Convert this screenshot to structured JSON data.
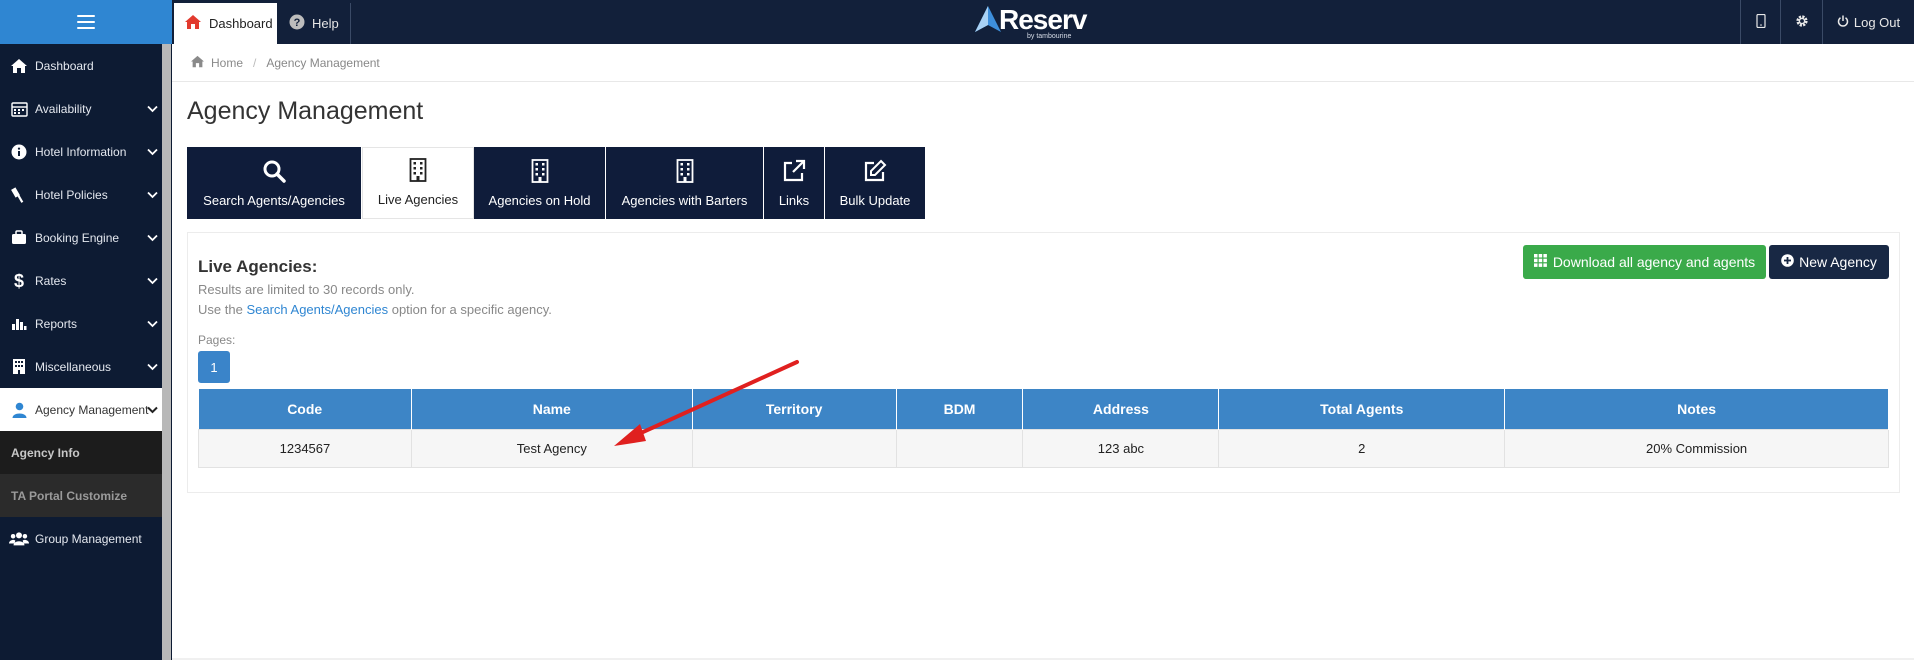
{
  "topbar": {
    "dashboard_label": "Dashboard",
    "help_label": "Help",
    "logo_text": "Reserv",
    "logo_by": "by tambourine",
    "logout_label": "Log Out"
  },
  "sidebar": {
    "items": [
      {
        "label": "Dashboard"
      },
      {
        "label": "Availability"
      },
      {
        "label": "Hotel Information"
      },
      {
        "label": "Hotel Policies"
      },
      {
        "label": "Booking Engine"
      },
      {
        "label": "Rates"
      },
      {
        "label": "Reports"
      },
      {
        "label": "Miscellaneous"
      },
      {
        "label": "Agency Management"
      },
      {
        "label": "Group Management"
      }
    ],
    "sub_items": [
      {
        "label": "Agency Info"
      },
      {
        "label": "TA Portal Customize"
      }
    ]
  },
  "breadcrumb": {
    "home": "Home",
    "separator": "/",
    "current": "Agency Management"
  },
  "page": {
    "title": "Agency Management"
  },
  "tabs": [
    {
      "label": "Search Agents/Agencies",
      "icon": "search-icon"
    },
    {
      "label": "Live Agencies",
      "icon": "building-icon"
    },
    {
      "label": "Agencies on Hold",
      "icon": "building-icon"
    },
    {
      "label": "Agencies with Barters",
      "icon": "building-icon"
    },
    {
      "label": "Links",
      "icon": "external-link-icon"
    },
    {
      "label": "Bulk Update",
      "icon": "edit-icon"
    }
  ],
  "panel": {
    "heading": "Live Agencies:",
    "note_limit": "Results are limited to 30 records only.",
    "note_use_prefix": "Use the",
    "note_link": "Search Agents/Agencies",
    "note_use_suffix": "option for a specific agency.",
    "pages_label": "Pages:",
    "page_number": "1",
    "download_label": "Download all agency and agents",
    "new_label": "New Agency"
  },
  "table": {
    "headers": [
      "Code",
      "Name",
      "Territory",
      "BDM",
      "Address",
      "Total Agents",
      "Notes"
    ],
    "rows": [
      [
        "1234567",
        "Test Agency",
        "",
        "",
        "123 abc",
        "2",
        "20% Commission"
      ]
    ]
  },
  "colors": {
    "navy": "#0f1c3a",
    "accent_blue": "#2f86d2",
    "table_header": "#3d85c6",
    "download_green": "#3aaa4a",
    "arrow_red": "#e0201f"
  }
}
